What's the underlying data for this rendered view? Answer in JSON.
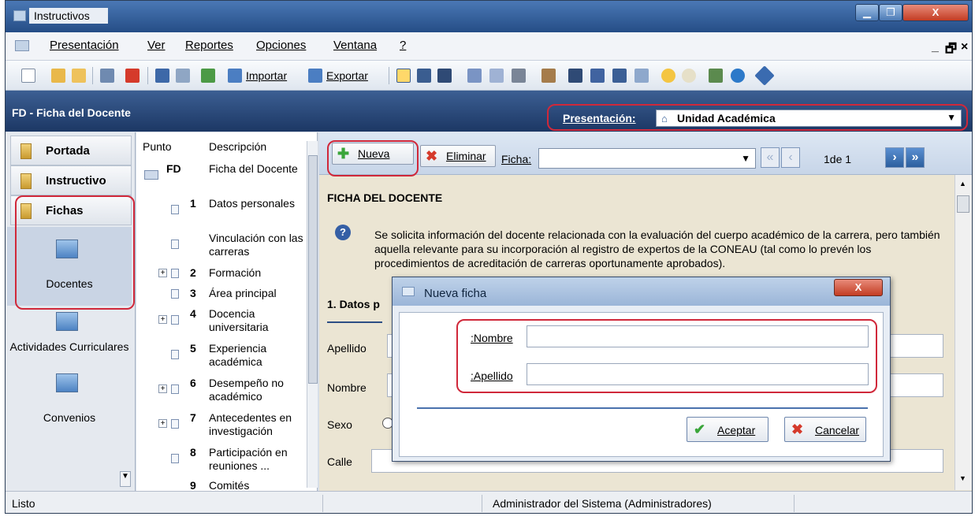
{
  "window": {
    "title": "Instructivos",
    "min_glyph": "▁",
    "max_glyph": "❐",
    "close_glyph": "X"
  },
  "menubar": {
    "items": [
      "Presentación",
      "Ver",
      "Reportes",
      "Opciones",
      "Ventana",
      "?"
    ],
    "mdi_min": "_",
    "mdi_max": "🗗",
    "mdi_close": "×"
  },
  "toolbar": {
    "importar": "Importar",
    "exportar": "Exportar"
  },
  "header": {
    "title": "FD - Ficha del Docente",
    "presentacion_label": "Presentación:",
    "presentacion_value": "Unidad Académica",
    "dropdown_glyph": "▼",
    "presentacion_icon": "institution-icon"
  },
  "sidebar": {
    "items": [
      "Portada",
      "Instructivo",
      "Fichas"
    ],
    "fichas_subitems": [
      "Docentes",
      "Actividades Curriculares",
      "Convenios"
    ]
  },
  "tree": {
    "col_punto": "Punto",
    "col_descripcion": "Descripción",
    "rows": [
      {
        "num": "FD",
        "desc": "Ficha del Docente"
      },
      {
        "num": "1",
        "desc": "Datos personales"
      },
      {
        "num": "",
        "desc": "Vinculación con las carreras"
      },
      {
        "num": "2",
        "desc": "Formación"
      },
      {
        "num": "3",
        "desc": "Área principal"
      },
      {
        "num": "4",
        "desc": "Docencia universitaria"
      },
      {
        "num": "5",
        "desc": "Experiencia académica"
      },
      {
        "num": "6",
        "desc": "Desempeño no académico"
      },
      {
        "num": "7",
        "desc": "Antecedentes en investigación"
      },
      {
        "num": "8",
        "desc": "Participación en reuniones ..."
      },
      {
        "num": "9",
        "desc": "Comités"
      }
    ]
  },
  "main": {
    "nueva_label": "Nueva",
    "eliminar_label": "Eliminar",
    "ficha_label": "Ficha:",
    "pager": "1de 1",
    "first_glyph": "«",
    "prev_glyph": "‹",
    "next_glyph": "›",
    "last_glyph": "»",
    "section_title": "FICHA DEL DOCENTE",
    "info_text": "Se solicita información del docente relacionada con la evaluación del cuerpo académico de la carrera, pero también aquella relevante para su incorporación al registro de expertos de la CONEAU (tal como lo prevén los procedimientos de acreditación de carreras oportunamente aprobados).",
    "subsection": "1. Datos p",
    "fields": {
      "apellido": "Apellido",
      "nombre": "Nombre",
      "sexo": "Sexo",
      "calle": "Calle"
    }
  },
  "status": {
    "left": "Listo",
    "user": "Administrador del Sistema (Administradores)"
  },
  "dialog": {
    "title": "Nueva ficha",
    "close_glyph": "X",
    "nombre_label": ":Nombre",
    "apellido_label": ":Apellido",
    "nombre_value": "",
    "apellido_value": "",
    "aceptar": "Aceptar",
    "cancelar": "Cancelar"
  },
  "colors": {
    "accent_red": "#d0283a",
    "header_blue": "#1c3764"
  }
}
